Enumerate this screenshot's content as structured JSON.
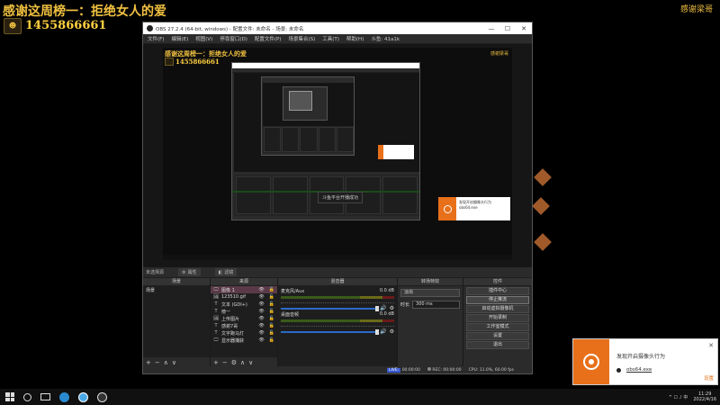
{
  "overlay": {
    "title": "感谢这周榜一：拒绝女人的爱",
    "number": "1455866661",
    "thanks": "感谢梁哥"
  },
  "obs": {
    "window_title": "OBS 27.2.4 (64-bit, windows) - 配置文件: 未命名 - 场景: 未命名",
    "menu": [
      "文件(F)",
      "编辑(E)",
      "视图(V)",
      "停靠窗口(D)",
      "配置文件(P)",
      "场景集合(S)",
      "工具(T)",
      "帮助(H)",
      "斗鱼: 41a1k"
    ],
    "window_controls": [
      "—",
      "☐",
      "✕"
    ],
    "canvas_toast": {
      "line1": "发现开启摄像头行为",
      "line2": "obs64.exe"
    },
    "nested_toast_label": "斗鱼平台开播成功",
    "scene_info": {
      "label": "未选择源",
      "properties": "属性",
      "filters": "滤镜"
    },
    "docks": {
      "scenes": {
        "header": "场景",
        "items": [
          "场景"
        ],
        "footer": [
          "+",
          "−",
          "∧",
          "∨"
        ]
      },
      "sources": {
        "header": "来源",
        "items": [
          {
            "icon": "🖵",
            "name": "图像 1",
            "selected": true
          },
          {
            "icon": "🖼",
            "name": "123510.gif",
            "selected": false
          },
          {
            "icon": "T",
            "name": "文本 (GDI+)",
            "selected": false
          },
          {
            "icon": "T",
            "name": "榜一",
            "selected": false
          },
          {
            "icon": "🖼",
            "name": "上传图片",
            "selected": false
          },
          {
            "icon": "T",
            "name": "感谢7哥",
            "selected": false
          },
          {
            "icon": "T",
            "name": "文字跑马灯",
            "selected": false
          },
          {
            "icon": "🖵",
            "name": "显示器捕获",
            "selected": false
          }
        ],
        "footer": [
          "+",
          "−",
          "⚙",
          "∧",
          "∨"
        ]
      },
      "mixer": {
        "header": "混音器",
        "channels": [
          {
            "name": "麦克风/Aux",
            "db": "0.0 dB"
          },
          {
            "name": "桌面音频",
            "db": "0.0 dB"
          }
        ]
      },
      "transitions": {
        "header": "转场特效",
        "selected": "淡出",
        "duration_label": "时长",
        "duration_value": "300 ms"
      },
      "controls": {
        "header": "控件",
        "buttons": [
          "插件中心",
          "停止推流",
          "启动虚拟摄像机",
          "开始录制",
          "工作室模式",
          "设置",
          "退出"
        ],
        "active": "停止推流"
      }
    },
    "statusbar": {
      "live_label": "LIVE:",
      "live_time": "00:00:00",
      "rec_label": "REC:",
      "rec_time": "00:00:00",
      "cpu": "CPU: 11.0%, 60.00 fps"
    }
  },
  "notification": {
    "message": "发现开启摄像头行为",
    "app": "obs64.exe",
    "close": "✕",
    "settings": "设置"
  },
  "taskbar": {
    "time": "11:29",
    "date": "2022/4/16",
    "tray": "^ ☐ ♪ 中"
  },
  "colors": {
    "accent_orange": "#e8701a",
    "overlay_gold": "#f0c040",
    "selection": "#5a3a48",
    "fader_blue": "#2a6ac8"
  }
}
